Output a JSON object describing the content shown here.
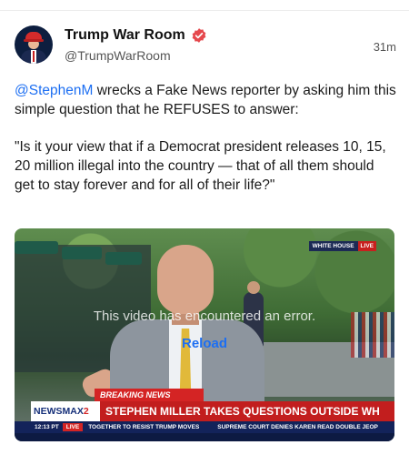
{
  "post": {
    "author": {
      "display_name": "Trump War Room",
      "handle": "@TrumpWarRoom",
      "verified": true,
      "verified_color": "#e5484d"
    },
    "timestamp": "31m",
    "text": {
      "mention": "@StephenM",
      "line1_rest": " wrecks a Fake News reporter by asking him this simple question that he REFUSES to answer:",
      "quote": "\"Is it your view that if a Democrat president releases 10, 15, 20 million illegal into the country — that of all them should get to stay forever and for all of their life?\""
    }
  },
  "video": {
    "error_message": "This video has encountered an error.",
    "reload_label": "Reload",
    "overlay": {
      "location_bug": "WHITE HOUSE",
      "live_bug": "LIVE",
      "breaking_label": "BREAKING NEWS",
      "network_name": "NEWSMAX",
      "network_suffix": "2",
      "headline": "STEPHEN MILLER TAKES QUESTIONS OUTSIDE WH",
      "ticker_time": "12:13 PT",
      "ticker_live": "LIVE",
      "ticker_items": [
        "TOGETHER TO RESIST TRUMP MOVES",
        "SUPREME COURT DENIES KAREN READ DOUBLE JEOP"
      ]
    }
  },
  "colors": {
    "link": "#1d6ff2",
    "newsmax_red": "#c21e1e",
    "newsmax_navy": "#13235a"
  }
}
